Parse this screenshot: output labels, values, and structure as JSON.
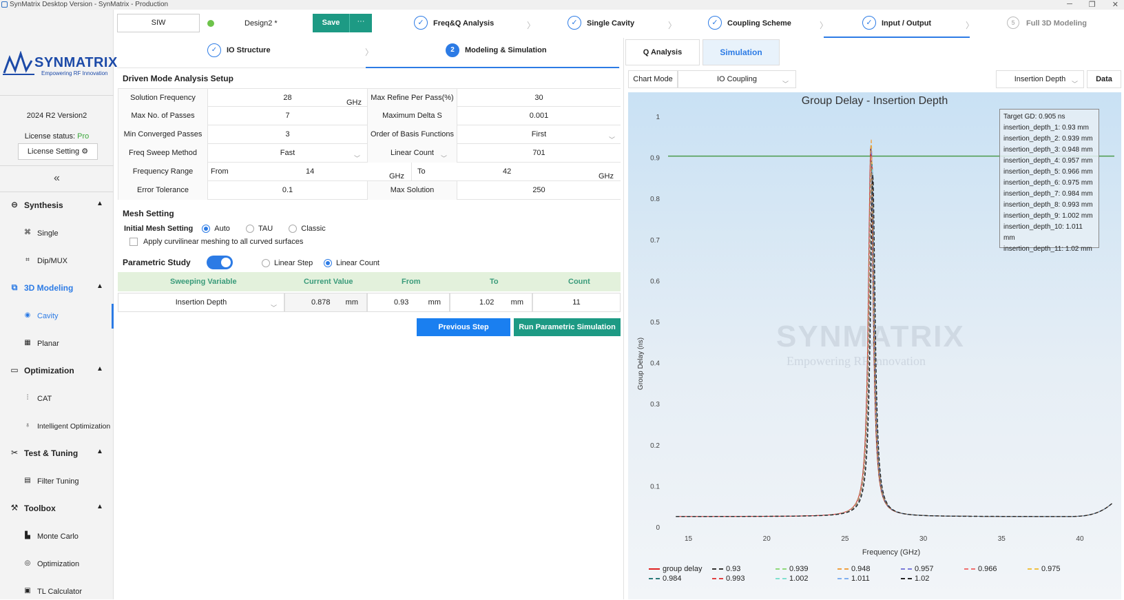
{
  "window": {
    "title": "SynMatrix Desktop Version - SynMatrix - Production"
  },
  "sidebar": {
    "brand": "SYNMATRIX",
    "brand_sub": "Empowering RF Innovation",
    "version": "2024 R2 Version2",
    "license_label": "License status:",
    "license_value": "Pro",
    "license_button": "License Setting",
    "collapse": "«",
    "sections": [
      {
        "label": "Synthesis",
        "items": [
          "Single",
          "Dip/MUX"
        ]
      },
      {
        "label": "3D Modeling",
        "items": [
          "Cavity",
          "Planar"
        ]
      },
      {
        "label": "Optimization",
        "items": [
          "CAT",
          "Intelligent Optimization"
        ]
      },
      {
        "label": "Test & Tuning",
        "items": [
          "Filter Tuning"
        ]
      },
      {
        "label": "Toolbox",
        "items": [
          "Monte Carlo",
          "Optimization",
          "TL Calculator"
        ]
      }
    ]
  },
  "topbar": {
    "siw": "SIW",
    "design": "Design2 *",
    "save": "Save",
    "more": "···",
    "steps": [
      {
        "label": "Freq&Q Analysis",
        "icon": "✓"
      },
      {
        "label": "Single Cavity",
        "icon": "✓"
      },
      {
        "label": "Coupling Scheme",
        "icon": "✓"
      },
      {
        "label": "Input / Output",
        "icon": "✓"
      },
      {
        "label": "Full 3D Modeling",
        "icon": "5"
      }
    ]
  },
  "subtabs": [
    {
      "label": "IO Structure",
      "icon": "✓"
    },
    {
      "label": "Modeling & Simulation",
      "icon": "2"
    }
  ],
  "setup": {
    "title": "Driven Mode Analysis Setup",
    "solution_frequency": {
      "label": "Solution Frequency",
      "value": "28",
      "unit": "GHz"
    },
    "max_refine": {
      "label": "Max Refine Per Pass(%)",
      "value": "30"
    },
    "max_passes": {
      "label": "Max No. of Passes",
      "value": "7"
    },
    "max_delta_s": {
      "label": "Maximum Delta S",
      "value": "0.001"
    },
    "min_converged": {
      "label": "Min Converged Passes",
      "value": "3"
    },
    "basis_order": {
      "label": "Order of Basis Functions",
      "value": "First"
    },
    "sweep_method": {
      "label": "Freq Sweep Method",
      "value": "Fast"
    },
    "linear_count": {
      "label": "Linear Count",
      "value": "701"
    },
    "freq_range": {
      "label": "Frequency Range",
      "from_label": "From",
      "from": "14",
      "to_label": "To",
      "to": "42",
      "unit": "GHz"
    },
    "error_tol": {
      "label": "Error Tolerance",
      "value": "0.1"
    },
    "max_solution": {
      "label": "Max Solution",
      "value": "250"
    }
  },
  "mesh": {
    "title": "Mesh Setting",
    "initial_label": "Initial Mesh Setting",
    "options": [
      "Auto",
      "TAU",
      "Classic"
    ],
    "curvilinear": "Apply curvilinear meshing to all curved surfaces"
  },
  "parametric": {
    "title": "Parametric Study",
    "opt_step": "Linear Step",
    "opt_count": "Linear Count",
    "headers": [
      "Sweeping Variable",
      "Current Value",
      "From",
      "To",
      "Count"
    ],
    "variable": "Insertion Depth",
    "current": "0.878",
    "from": "0.93",
    "to": "1.02",
    "count": "11",
    "unit": "mm"
  },
  "buttons": {
    "prev": "Previous Step",
    "run": "Run Parametric Simulation"
  },
  "right": {
    "tabs": [
      "Q Analysis",
      "Simulation"
    ],
    "chart_mode_label": "Chart Mode",
    "chart_mode": "IO Coupling",
    "view": "Insertion Depth",
    "data": "Data",
    "watermark": "SYNMATRIX",
    "watermark_sub": "Empowering RF Innovation"
  },
  "chart_data": {
    "type": "line",
    "title": "Group Delay - Insertion Depth",
    "xlabel": "Frequency (GHz)",
    "ylabel": "Group Delay (ns)",
    "xlim": [
      13.7,
      42.2
    ],
    "ylim": [
      0,
      1
    ],
    "xticks": [
      15,
      20,
      25,
      30,
      35,
      40
    ],
    "yticks": [
      0,
      0.1,
      0.2,
      0.3,
      0.4,
      0.5,
      0.6,
      0.7,
      0.8,
      0.9,
      1
    ],
    "target_gd": 0.905,
    "legend_box": [
      "Target GD: 0.905 ns",
      "insertion_depth_1: 0.93 mm",
      "insertion_depth_2: 0.939 mm",
      "insertion_depth_3: 0.948 mm",
      "insertion_depth_4: 0.957 mm",
      "insertion_depth_5: 0.966 mm",
      "insertion_depth_6: 0.975 mm",
      "insertion_depth_7: 0.984 mm",
      "insertion_depth_8: 0.993 mm",
      "insertion_depth_9: 1.002 mm",
      "insertion_depth_10: 1.011 mm",
      "insertion_depth_11: 1.02 mm"
    ],
    "series": [
      {
        "name": "group delay",
        "color": "#e02020",
        "peak": 0.93
      },
      {
        "name": "0.93",
        "color": "#333333",
        "peak": 0.93
      },
      {
        "name": "0.939",
        "color": "#8fd97a",
        "peak": 0.939
      },
      {
        "name": "0.948",
        "color": "#f0a040",
        "peak": 0.948
      },
      {
        "name": "0.957",
        "color": "#7a7ad9",
        "peak": 0.92
      },
      {
        "name": "0.966",
        "color": "#f07070",
        "peak": 0.91
      },
      {
        "name": "0.975",
        "color": "#f0c040",
        "peak": 0.9
      },
      {
        "name": "0.984",
        "color": "#2a7a7a",
        "peak": 0.89
      },
      {
        "name": "0.993",
        "color": "#e04040",
        "peak": 0.88
      },
      {
        "name": "1.002",
        "color": "#80e0d0",
        "peak": 0.875
      },
      {
        "name": "1.011",
        "color": "#80b0f0",
        "peak": 0.87
      },
      {
        "name": "1.02",
        "color": "#222222",
        "peak": 0.86
      }
    ],
    "center_ghz": 26.7,
    "baseline": [
      [
        14.2,
        0.027
      ],
      [
        20,
        0.028
      ],
      [
        24,
        0.045
      ],
      [
        25.5,
        0.12
      ],
      [
        26.7,
        0.93
      ],
      [
        28,
        0.12
      ],
      [
        29.5,
        0.045
      ],
      [
        35,
        0.03
      ],
      [
        40,
        0.05
      ],
      [
        42,
        0.17
      ]
    ],
    "target_color": "#4a9a4a"
  }
}
